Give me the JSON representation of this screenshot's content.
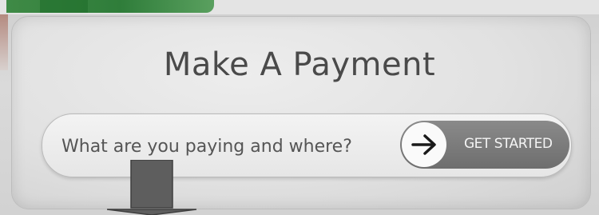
{
  "header": {
    "title": "Make A Payment"
  },
  "search": {
    "placeholder": "What are you paying and where?",
    "button_label": "GET STARTED",
    "button_icon": "arrow-right-icon"
  },
  "decorations": {
    "pointer_icon": "arrow-down-icon"
  },
  "colors": {
    "background": "#d9d9d9",
    "card": "#e3e3e3",
    "title_text": "#4a4a4a",
    "button_bg": "#7a7a7a",
    "accent_green": "#2f7d3a"
  }
}
